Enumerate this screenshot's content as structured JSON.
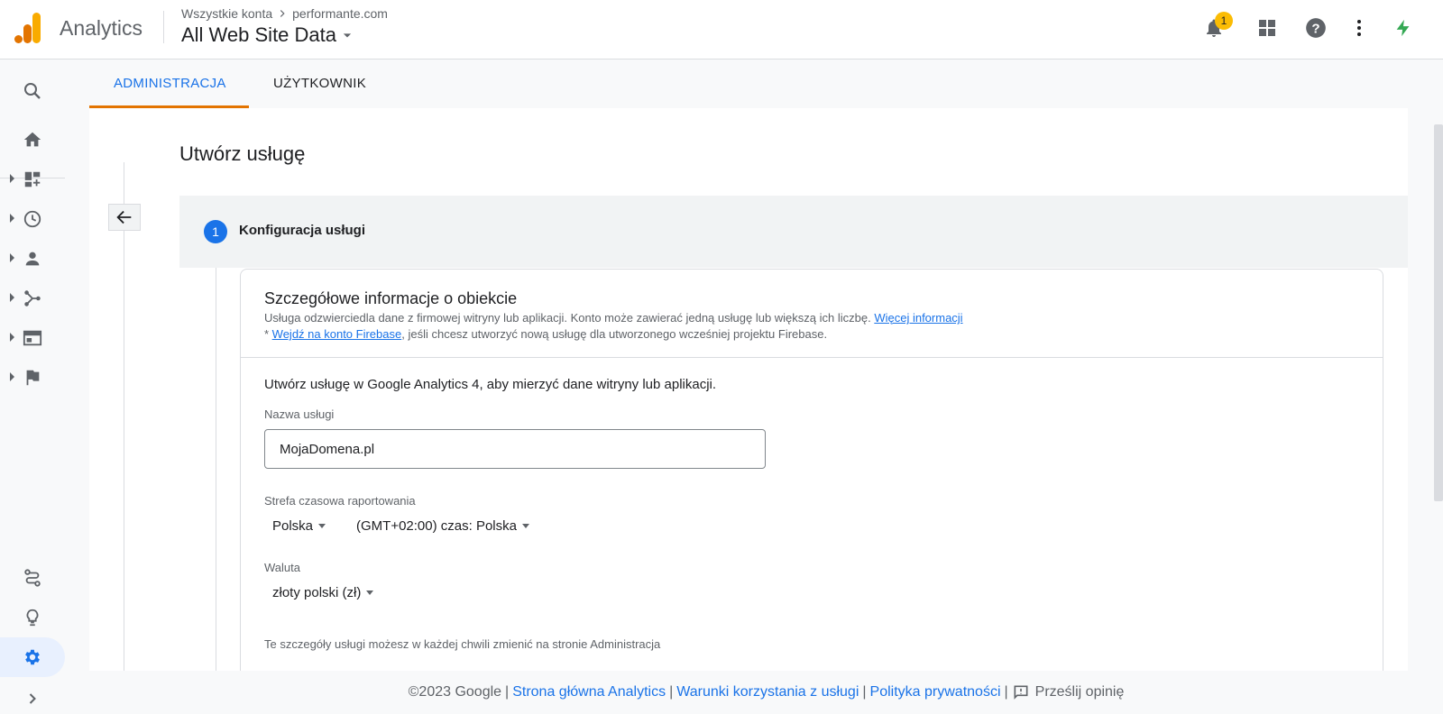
{
  "header": {
    "brand": "Analytics",
    "breadcrumb_root": "Wszystkie konta",
    "breadcrumb_account": "performante.com",
    "property": "All Web Site Data",
    "notification_count": "1"
  },
  "tabs": [
    {
      "label": "ADMINISTRACJA",
      "active": true
    },
    {
      "label": "UŻYTKOWNIK",
      "active": false
    }
  ],
  "page": {
    "title": "Utwórz usługę",
    "step_number": "1",
    "step_label": "Konfiguracja usługi"
  },
  "card": {
    "title": "Szczegółowe informacje o obiekcie",
    "desc": "Usługa odzwierciedla dane z firmowej witryny lub aplikacji. Konto może zawierać jedną usługę lub większą ich liczbę. ",
    "desc_link": "Więcej informacji",
    "desc2_prefix": "* ",
    "desc2_link": "Wejdź na konto Firebase",
    "desc2_suffix": ", jeśli chcesz utworzyć nową usługę dla utworzonego wcześniej projektu Firebase.",
    "intro": "Utwórz usługę w Google Analytics 4, aby mierzyć dane witryny lub aplikacji.",
    "name_label": "Nazwa usługi",
    "name_value": "MojaDomena.pl",
    "timezone_label": "Strefa czasowa raportowania",
    "country_value": "Polska",
    "timezone_value": "(GMT+02:00) czas: Polska",
    "currency_label": "Waluta",
    "currency_value": "złoty polski (zł)",
    "note": "Te szczegóły usługi możesz w każdej chwili zmienić na stronie Administracja"
  },
  "footer": {
    "copyright": "©2023 Google",
    "link1": "Strona główna Analytics",
    "link2": "Warunki korzystania z usługi",
    "link3": "Polityka prywatności",
    "feedback": "Prześlij opinię"
  },
  "colors": {
    "accent": "#1a73e8",
    "tab_indicator": "#e37400",
    "badge": "#fbbc04"
  }
}
